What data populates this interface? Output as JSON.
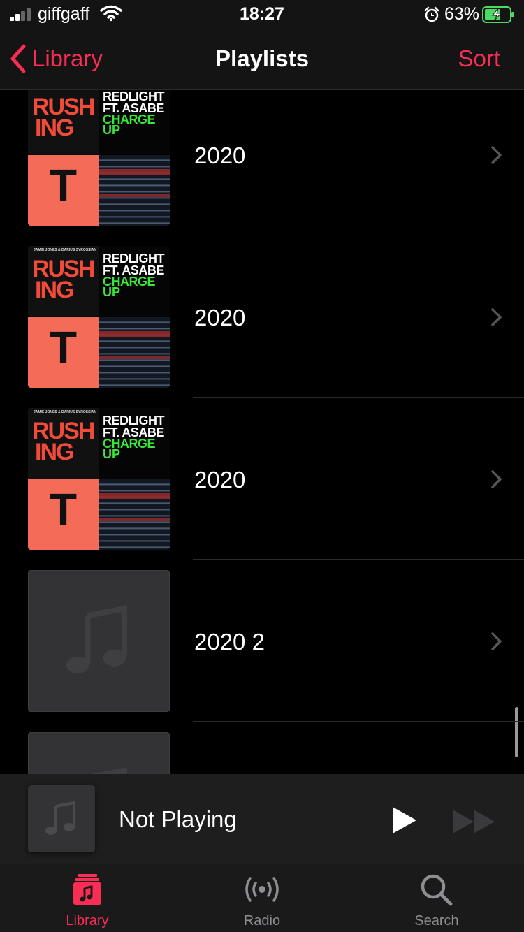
{
  "status_bar": {
    "carrier": "giffgaff",
    "time": "18:27",
    "battery_percent": "63%",
    "signal_bars": 2,
    "icons": [
      "signal-icon",
      "wifi-icon",
      "alarm-icon",
      "battery-charging-icon"
    ]
  },
  "nav": {
    "back_label": "Library",
    "title": "Playlists",
    "sort_label": "Sort"
  },
  "playlists": [
    {
      "title": "2020",
      "artwork": "mosaic"
    },
    {
      "title": "2020",
      "artwork": "mosaic"
    },
    {
      "title": "2020",
      "artwork": "mosaic"
    },
    {
      "title": "2020 2",
      "artwork": "placeholder"
    },
    {
      "title": "",
      "artwork": "placeholder"
    }
  ],
  "artwork_texts": {
    "q1_header": "JAMIE JONES & DARIUS SYROSSIAN",
    "q1_word1": "RUSH",
    "q1_word2": "ING",
    "q2_line1": "REDLIGHT",
    "q2_line2": "FT. ASABE",
    "q2_line3": "CHARGE",
    "q2_line4": "UP",
    "q3_letter": "T"
  },
  "mini_player": {
    "title": "Not Playing"
  },
  "tabs": [
    {
      "label": "Library",
      "icon": "library-icon",
      "active": true
    },
    {
      "label": "Radio",
      "icon": "radio-icon",
      "active": false
    },
    {
      "label": "Search",
      "icon": "search-icon",
      "active": false
    }
  ],
  "colors": {
    "accent": "#fa2d55",
    "background": "#000000",
    "bar_background": "#1a1a1a",
    "inactive_tab": "#8e8e93",
    "placeholder_art": "#333335"
  }
}
